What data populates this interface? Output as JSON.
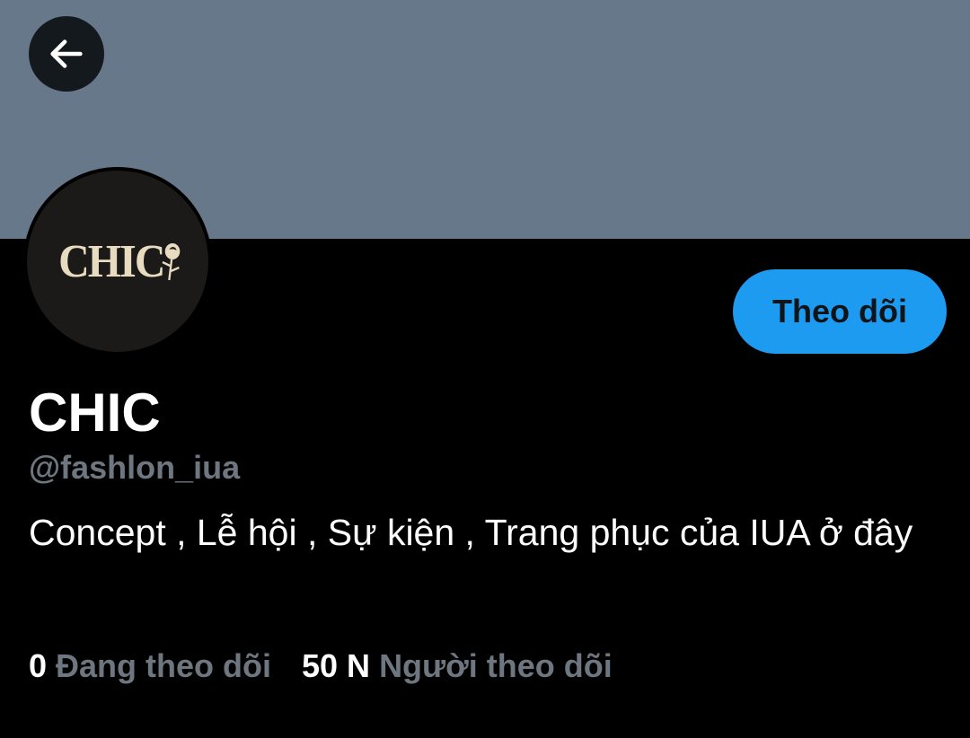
{
  "header": {
    "back_icon": "arrow-left-icon"
  },
  "colors": {
    "banner": "#66788a",
    "accent": "#1d9bf0",
    "muted_text": "#6e7680",
    "background": "#000000"
  },
  "profile": {
    "avatar_text": "CHIC",
    "avatar_icon": "rose-icon",
    "display_name": "CHIC",
    "handle": "@fashlon_iua",
    "bio": "Concept , Lễ hội , Sự kiện , Trang phục của IUA ở đây",
    "follow_label": "Theo dõi"
  },
  "stats": {
    "following_count": "0",
    "following_label": "Đang theo dõi",
    "followers_count": "50 N",
    "followers_label": "Người theo dõi"
  }
}
